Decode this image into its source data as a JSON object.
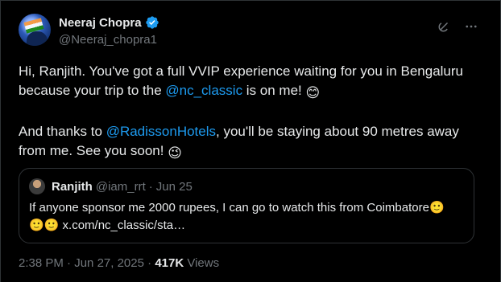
{
  "colors": {
    "background": "#000000",
    "text": "#e7e9ea",
    "secondary": "#71767b",
    "link": "#1d9bf0",
    "border": "#2f3336"
  },
  "author": {
    "name": "Neeraj Chopra",
    "handle": "@Neeraj_chopra1",
    "verified_icon": "verified-badge-icon"
  },
  "actions": {
    "grok_icon": "grok-icon",
    "more_icon": "more-icon"
  },
  "tweet": {
    "p1_before": "Hi, Ranjith. You've got a full VVIP experience waiting for you in Bengaluru because your trip to the ",
    "p1_mention": "@nc_classic",
    "p1_after": " is on me! ",
    "p1_emoji": "😊",
    "p2_before": "And thanks to ",
    "p2_mention": "@RadissonHotels",
    "p2_after": ", you'll be staying about 90 metres away from me. See you soon! ",
    "p2_emoji": "😉"
  },
  "quote": {
    "name": "Ranjith",
    "handle": "@iam_rrt",
    "separator": "·",
    "date": "Jun 25",
    "text_line1": "If anyone sponsor me 2000 rupees, I can go to watch this from Coimbatore",
    "emoji1": "🙂",
    "emoji2": "🙂",
    "emoji3": "🙂",
    "link": "x.com/nc_classic/sta…"
  },
  "footer": {
    "time": "2:38 PM",
    "sep1": "·",
    "date": "Jun 27, 2025",
    "sep2": "·",
    "views_count": "417K",
    "views_label": "Views"
  }
}
